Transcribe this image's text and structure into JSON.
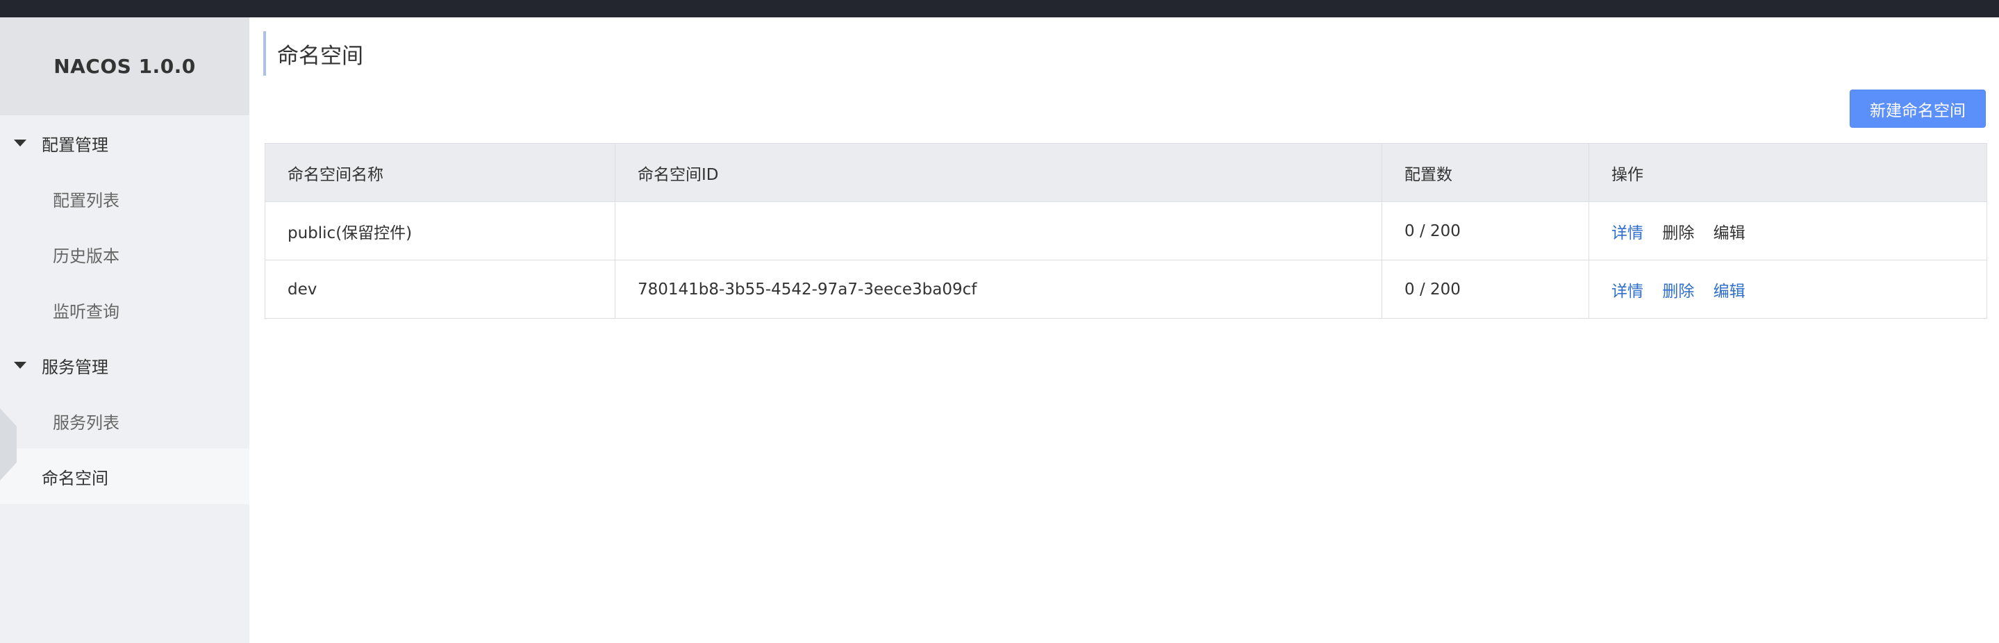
{
  "app": {
    "logo": "NACOS 1.0.0"
  },
  "sidebar": {
    "groups": [
      {
        "label": "配置管理",
        "items": [
          "配置列表",
          "历史版本",
          "监听查询"
        ]
      },
      {
        "label": "服务管理",
        "items": [
          "服务列表"
        ]
      }
    ],
    "top_item": "命名空间"
  },
  "main": {
    "title": "命名空间",
    "new_button": "新建命名空间",
    "table": {
      "headers": [
        "命名空间名称",
        "命名空间ID",
        "配置数",
        "操作"
      ],
      "rows": [
        {
          "name": "public(保留控件)",
          "id": "",
          "config_count": "0 / 200",
          "ops": [
            "详情",
            "删除",
            "编辑"
          ]
        },
        {
          "name": "dev",
          "id": "780141b8-3b55-4542-97a7-3eece3ba09cf",
          "config_count": "0 / 200",
          "ops": [
            "详情",
            "删除",
            "编辑"
          ]
        }
      ]
    }
  },
  "colors": {
    "topbar": "#23262e",
    "accent": "#5b8ff9",
    "link": "#2f6fcb"
  }
}
